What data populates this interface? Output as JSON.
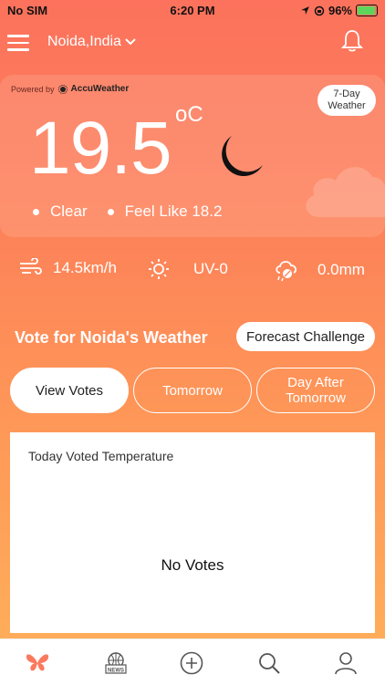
{
  "status_bar": {
    "carrier": "No SIM",
    "time": "6:20 PM",
    "battery": "96%"
  },
  "header": {
    "location": "Noida,India"
  },
  "weather": {
    "powered_by": "Powered by",
    "provider": "AccuWeather",
    "seven_day": "7-Day Weather",
    "temperature": "19.5",
    "unit": "oC",
    "condition": "Clear",
    "feels_like": "Feel Like 18.2"
  },
  "stats": {
    "wind": "14.5km/h",
    "uv": "UV-0",
    "precip": "0.0mm"
  },
  "vote": {
    "title": "Vote for Noida's Weather",
    "forecast_button": "Forecast Challenge",
    "tabs": [
      {
        "label": "View Votes",
        "active": true
      },
      {
        "label": "Tomorrow",
        "active": false
      },
      {
        "label": "Day After Tomorrow",
        "active": false
      }
    ],
    "panel_title": "Today Voted Temperature",
    "empty_text": "No Votes"
  },
  "bottom_nav": {
    "news_label": "NEWS",
    "items": [
      "butterfly-icon",
      "news-icon",
      "add-icon",
      "search-icon",
      "profile-icon"
    ]
  },
  "colors": {
    "accent": "#fc725c",
    "accent2": "#ffb15a",
    "active_nav": "#fb7a5e"
  }
}
